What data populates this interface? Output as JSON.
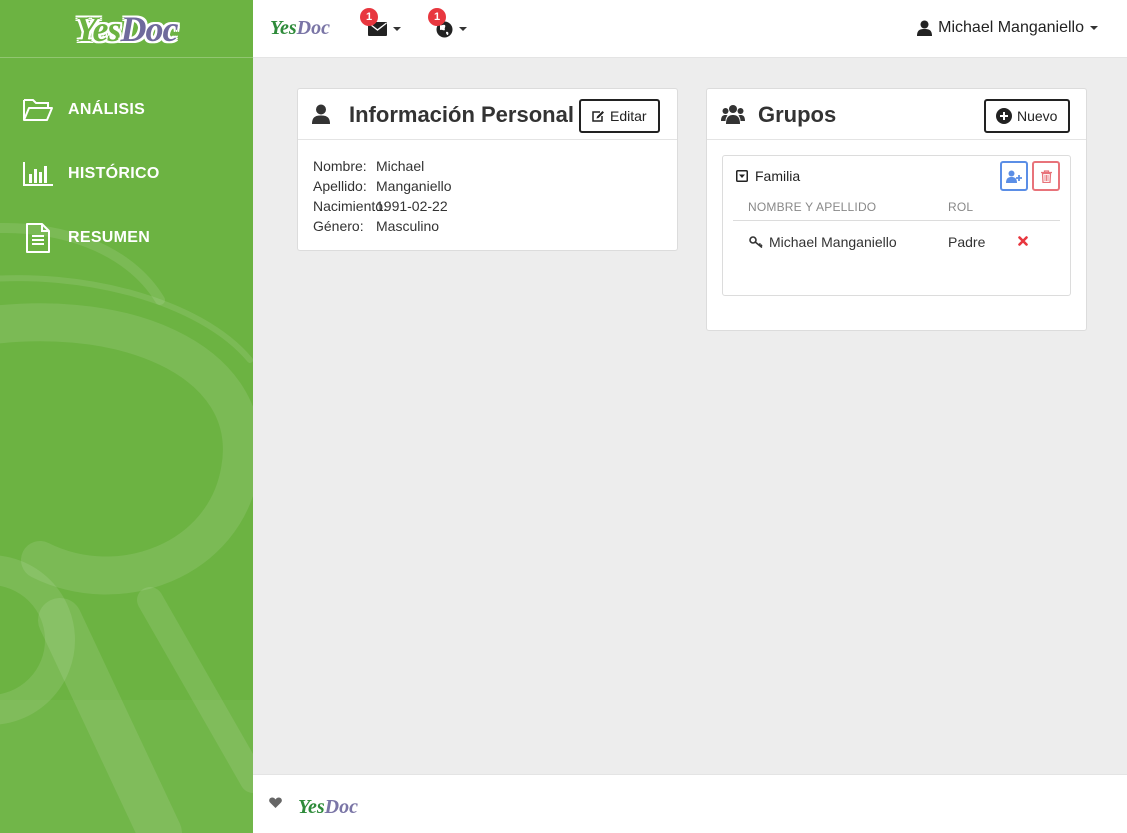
{
  "brand": {
    "logo_yes": "Yes",
    "logo_doc": "Doc"
  },
  "sidebar": {
    "items": [
      {
        "label": "ANÁLISIS",
        "icon": "folder-open-icon"
      },
      {
        "label": "HISTÓRICO",
        "icon": "bar-chart-icon"
      },
      {
        "label": "RESUMEN",
        "icon": "document-icon"
      }
    ]
  },
  "topbar": {
    "logo_yes": "Yes",
    "logo_doc": "Doc",
    "messages": {
      "count": "1",
      "icon": "envelope-icon"
    },
    "globe": {
      "count": "1",
      "icon": "globe-icon"
    },
    "user_name": "Michael Manganiello"
  },
  "personal": {
    "title": "Información Personal",
    "edit_label": "Editar",
    "fields": [
      {
        "label": "Nombre:",
        "value": "Michael"
      },
      {
        "label": "Apellido:",
        "value": "Manganiello"
      },
      {
        "label": "Nacimiento:",
        "value": "1991-02-22"
      },
      {
        "label": "Género:",
        "value": "Masculino"
      }
    ]
  },
  "groups": {
    "title": "Grupos",
    "new_label": "Nuevo",
    "group": {
      "name": "Familia",
      "col_name": "NOMBRE Y APELLIDO",
      "col_role": "ROL",
      "members": [
        {
          "name": "Michael Manganiello",
          "role": "Padre"
        }
      ]
    }
  },
  "footer": {
    "logo_yes": "Yes",
    "logo_doc": "Doc"
  },
  "colors": {
    "sidebar": "#6cb342",
    "badge": "#e8373f",
    "blue": "#5b8ee6",
    "red": "#e8737a"
  }
}
